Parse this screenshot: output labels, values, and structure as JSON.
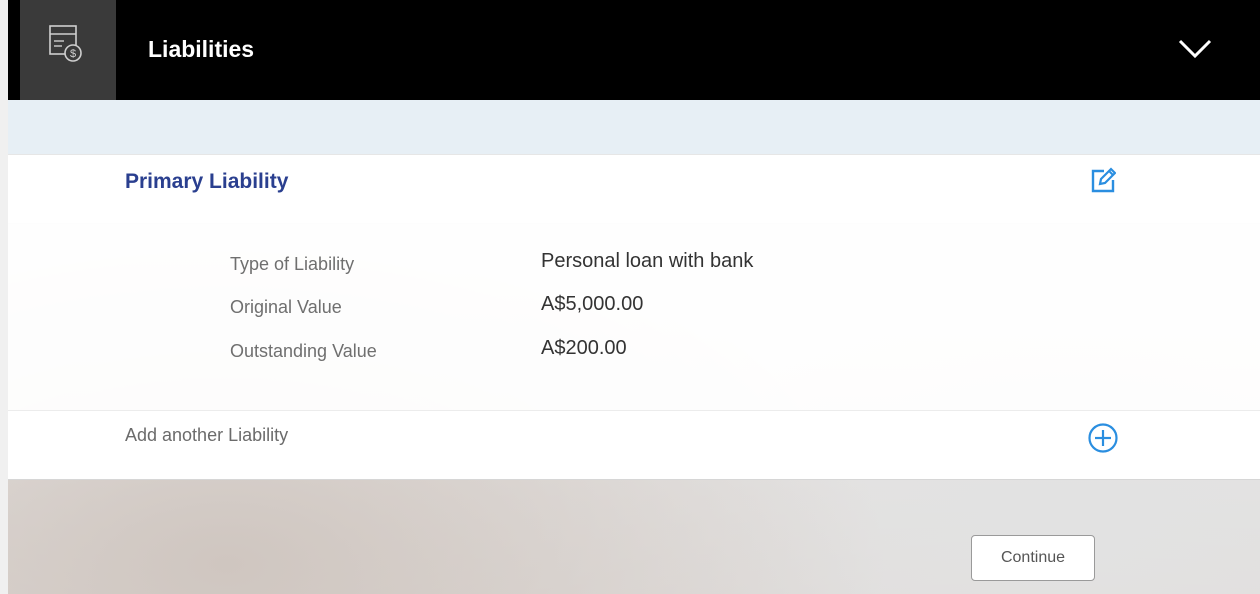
{
  "header": {
    "title": "Liabilities",
    "icon": "bill-dollar-icon",
    "toggle_icon": "chevron-down-icon"
  },
  "liability": {
    "name": "Primary Liability",
    "edit_icon": "edit-icon",
    "fields": [
      {
        "label": "Type of Liability",
        "value": "Personal loan with bank"
      },
      {
        "label": "Original Value",
        "value": "A$5,000.00"
      },
      {
        "label": "Outstanding Value",
        "value": "A$200.00"
      }
    ]
  },
  "add_another": {
    "label": "Add another Liability",
    "icon": "add-circle-icon"
  },
  "actions": {
    "continue_label": "Continue"
  },
  "colors": {
    "header_bg": "#000000",
    "icon_box_bg": "#3a3a3a",
    "title_blue": "#2a3f8f",
    "accent_blue": "#2a8ee0",
    "band_bg": "#e7eff5"
  }
}
